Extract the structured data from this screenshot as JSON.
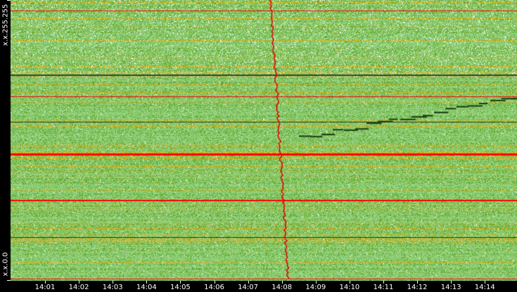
{
  "chart_data": {
    "type": "heatmap",
    "title": "",
    "xlabel": "",
    "ylabel": "",
    "y_tick_labels": [
      "x.x.255.255",
      "x.x.0.0"
    ],
    "x_tick_labels": [
      "14:01",
      "14:02",
      "14:03",
      "14:04",
      "14:05",
      "14:06",
      "14:07",
      "14:08",
      "14:09",
      "14:10",
      "14:11",
      "14:12",
      "14:13",
      "14:14"
    ],
    "color_scale": [
      "#ffffff",
      "#8fcf7a",
      "#6db33f",
      "#5a9e1f",
      "#ffa500",
      "#ff0000"
    ],
    "grid": false
  }
}
